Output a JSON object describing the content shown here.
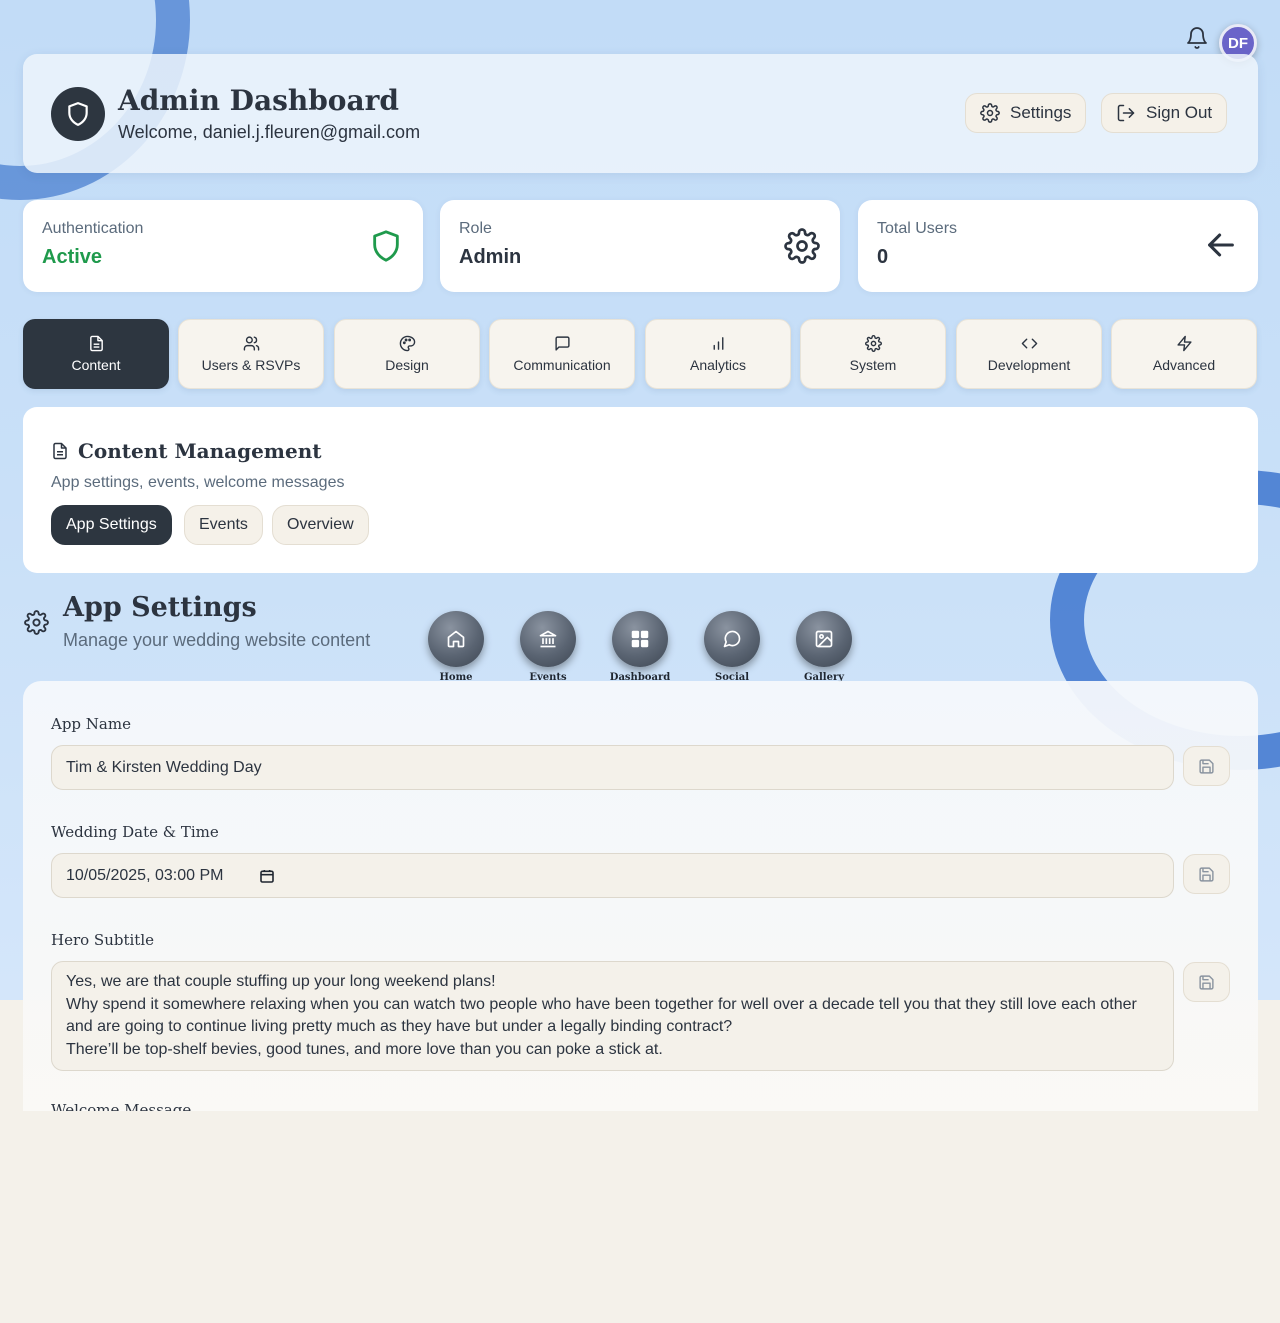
{
  "header": {
    "title": "Admin Dashboard",
    "welcome": "Welcome, daniel.j.fleuren@gmail.com",
    "settings_label": "Settings",
    "signout_label": "Sign Out"
  },
  "user": {
    "initials": "DF"
  },
  "stats": {
    "auth_label": "Authentication",
    "auth_value": "Active",
    "role_label": "Role",
    "role_value": "Admin",
    "users_label": "Total Users",
    "users_value": "0"
  },
  "tabs": [
    {
      "label": "Content",
      "icon": "document-icon"
    },
    {
      "label": "Users & RSVPs",
      "icon": "users-icon"
    },
    {
      "label": "Design",
      "icon": "palette-icon"
    },
    {
      "label": "Communication",
      "icon": "message-icon"
    },
    {
      "label": "Analytics",
      "icon": "bar-chart-icon"
    },
    {
      "label": "System",
      "icon": "gear-icon"
    },
    {
      "label": "Development",
      "icon": "code-icon"
    },
    {
      "label": "Advanced",
      "icon": "lightning-icon"
    }
  ],
  "content_management": {
    "title": "Content Management",
    "subtitle": "App settings, events, welcome messages",
    "pills": [
      "App Settings",
      "Events",
      "Overview"
    ]
  },
  "app_settings": {
    "title": "App Settings",
    "subtitle": "Manage your wedding website content"
  },
  "nav_bubbles": [
    "Home",
    "Events",
    "Dashboard",
    "Social",
    "Gallery"
  ],
  "form": {
    "app_name_label": "App Name",
    "app_name_value": "Tim & Kirsten Wedding Day",
    "date_label": "Wedding Date & Time",
    "date_value": "10/05/2025, 03:00 PM",
    "hero_label": "Hero Subtitle",
    "hero_lines": [
      "Yes, we are that couple stuffing up your long weekend plans!",
      "Why spend it somewhere relaxing when you can watch two people who have been together for well over a decade tell you that they still love each other and are going to continue living pretty much as they have but under a legally binding contract?",
      "There’ll be top-shelf bevies, good tunes, and more love than you can poke a stick at."
    ],
    "welcome_label": "Welcome Message"
  },
  "colors": {
    "accent_dark": "#2d3640",
    "active_green": "#1f9a4c",
    "avatar_purple": "#6a64c9"
  }
}
